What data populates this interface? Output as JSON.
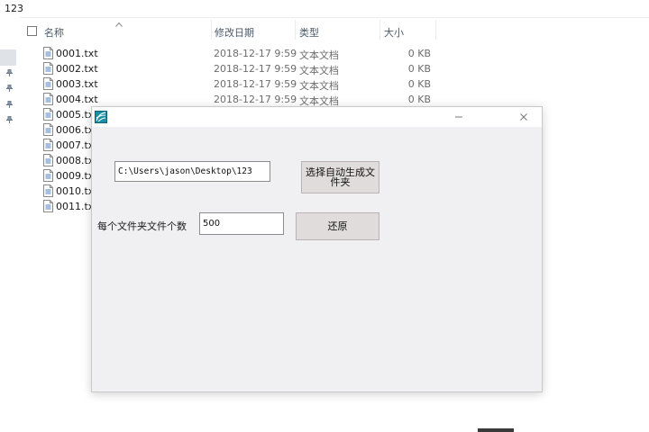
{
  "explorer": {
    "address": "123",
    "columns": {
      "name": "名称",
      "modified": "修改日期",
      "type": "类型",
      "size": "大小"
    },
    "files": [
      {
        "name": "0001.txt",
        "date": "2018-12-17 9:59",
        "type": "文本文档",
        "size": "0 KB"
      },
      {
        "name": "0002.txt",
        "date": "2018-12-17 9:59",
        "type": "文本文档",
        "size": "0 KB"
      },
      {
        "name": "0003.txt",
        "date": "2018-12-17 9:59",
        "type": "文本文档",
        "size": "0 KB"
      },
      {
        "name": "0004.txt",
        "date": "2018-12-17 9:59",
        "type": "文本文档",
        "size": "0 KB"
      },
      {
        "name": "0005.txt"
      },
      {
        "name": "0006.txt"
      },
      {
        "name": "0007.txt"
      },
      {
        "name": "0008.txt"
      },
      {
        "name": "0009.txt"
      },
      {
        "name": "0010.txt"
      },
      {
        "name": "0011.txt"
      }
    ]
  },
  "dialog": {
    "path_value": "C:\\Users\\jason\\Desktop\\123",
    "select_button": "选择自动生成文件夹",
    "count_label": "每个文件夹文件个数",
    "count_value": "500",
    "restore_button": "还原"
  },
  "icons": {
    "app": "app-logo-icon",
    "minimize": "minimize-icon",
    "close": "close-icon",
    "file": "text-file-icon",
    "pin": "pin-icon"
  }
}
